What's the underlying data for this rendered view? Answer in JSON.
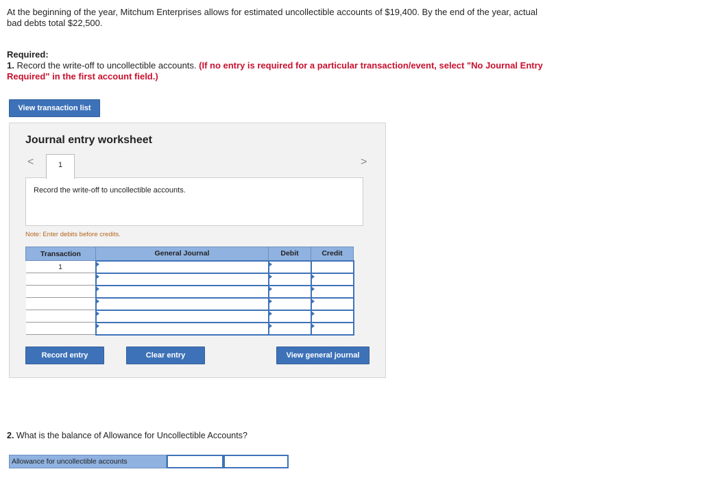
{
  "intro": "At the beginning of the year, Mitchum Enterprises allows for estimated uncollectible accounts of $19,400. By the end of the year, actual bad debts total $22,500.",
  "required": {
    "heading": "Required:",
    "item1_num": "1.",
    "item1_text": " Record the write-off to uncollectible accounts. ",
    "item1_instruction": "(If no entry is required for a particular transaction/event, select \"No Journal Entry Required\" in the first account field.)"
  },
  "buttons": {
    "view_transaction_list": "View transaction list",
    "record_entry": "Record entry",
    "clear_entry": "Clear entry",
    "view_general_journal": "View general journal"
  },
  "worksheet": {
    "title": "Journal entry worksheet",
    "prev_arrow": "<",
    "next_arrow": ">",
    "tab_label": "1",
    "description": "Record the write-off to uncollectible accounts.",
    "note": "Note: Enter debits before credits."
  },
  "journal_table": {
    "headers": [
      "Transaction",
      "General Journal",
      "Debit",
      "Credit"
    ],
    "rows": [
      {
        "transaction": "1",
        "account": "",
        "debit": "",
        "credit": ""
      },
      {
        "transaction": "",
        "account": "",
        "debit": "",
        "credit": ""
      },
      {
        "transaction": "",
        "account": "",
        "debit": "",
        "credit": ""
      },
      {
        "transaction": "",
        "account": "",
        "debit": "",
        "credit": ""
      },
      {
        "transaction": "",
        "account": "",
        "debit": "",
        "credit": ""
      },
      {
        "transaction": "",
        "account": "",
        "debit": "",
        "credit": ""
      }
    ]
  },
  "question2": {
    "num": "2.",
    "text": " What is the balance of Allowance for Uncollectible Accounts?",
    "answer_label": "Allowance for uncollectible accounts",
    "answer_value": "",
    "answer_value2": ""
  },
  "colors": {
    "button_blue": "#3e72b8",
    "header_blue": "#8fb2e0",
    "instruction_red": "#c8102e",
    "note_orange": "#b5651d"
  }
}
